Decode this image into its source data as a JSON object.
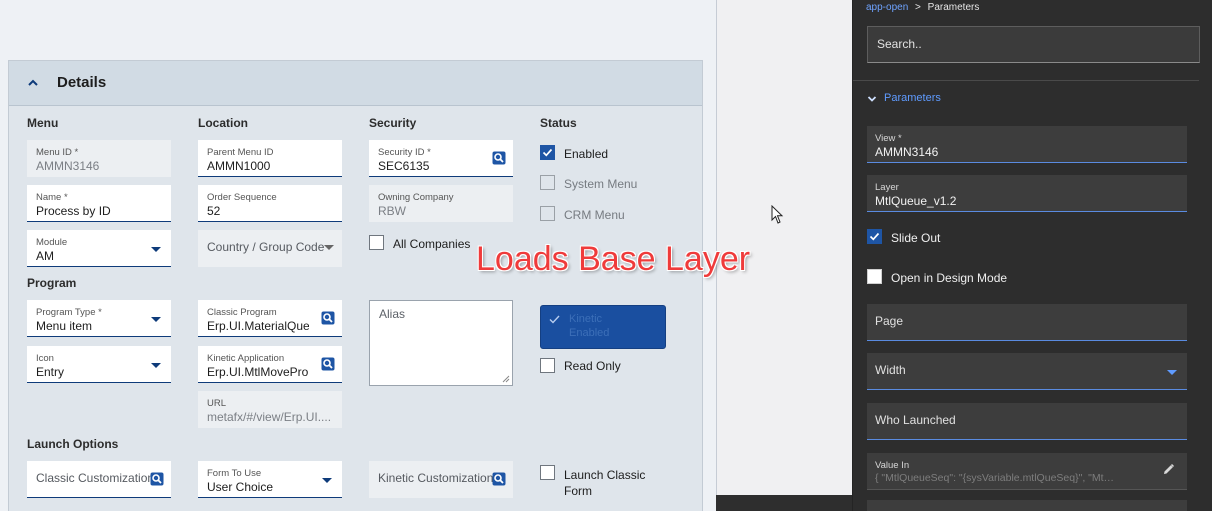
{
  "details": {
    "title": "Details",
    "sections": {
      "menu": "Menu",
      "location": "Location",
      "security": "Security",
      "status": "Status",
      "program": "Program",
      "launch_options": "Launch Options"
    },
    "menu_id": {
      "label": "Menu ID *",
      "value": "AMMN3146"
    },
    "name": {
      "label": "Name *",
      "value": "Process by ID"
    },
    "module": {
      "label": "Module",
      "value": "AM"
    },
    "parent_menu_id": {
      "label": "Parent Menu ID",
      "value": "AMMN1000"
    },
    "order_sequence": {
      "label": "Order Sequence",
      "value": "52"
    },
    "country_group_code": {
      "placeholder": "Country / Group Code"
    },
    "security_id": {
      "label": "Security ID *",
      "value": "SEC6135"
    },
    "owning_company": {
      "label": "Owning Company",
      "value": "RBW"
    },
    "all_companies": {
      "label": "All Companies",
      "checked": false
    },
    "enabled": {
      "label": "Enabled",
      "checked": true
    },
    "system_menu": {
      "label": "System Menu",
      "checked": false
    },
    "crm_menu": {
      "label": "CRM Menu",
      "checked": false
    },
    "program_type": {
      "label": "Program Type *",
      "value": "Menu item"
    },
    "icon": {
      "label": "Icon",
      "value": "Entry"
    },
    "classic_program": {
      "label": "Classic Program",
      "value": "Erp.UI.MaterialQue"
    },
    "kinetic_application": {
      "label": "Kinetic Application",
      "value": "Erp.UI.MtlMovePro"
    },
    "url": {
      "label": "URL",
      "value": "metafx/#/view/Erp.UI...."
    },
    "alias": {
      "placeholder": "Alias"
    },
    "kinetic_enabled": {
      "label": "Kinetic Enabled",
      "checked": true
    },
    "read_only": {
      "label": "Read Only",
      "checked": false
    },
    "classic_customization": {
      "placeholder": "Classic Customization"
    },
    "form_to_use": {
      "label": "Form To Use",
      "value": "User Choice"
    },
    "kinetic_customization": {
      "placeholder": "Kinetic Customization"
    },
    "launch_classic_form": {
      "label": "Launch Classic Form",
      "checked": false
    }
  },
  "overlay_text": "Loads Base Layer",
  "properties_panel": {
    "breadcrumb": {
      "parent": "app-open",
      "separator": ">",
      "current": "Parameters"
    },
    "search_placeholder": "Search..",
    "section_title": "Parameters",
    "view": {
      "label": "View *",
      "value": "AMMN3146"
    },
    "layer": {
      "label": "Layer",
      "value": "MtlQueue_v1.2"
    },
    "slide_out": {
      "label": "Slide Out",
      "checked": true
    },
    "open_in_design_mode": {
      "label": "Open in Design Mode",
      "checked": false
    },
    "page": {
      "placeholder": "Page"
    },
    "width": {
      "placeholder": "Width"
    },
    "who_launched": {
      "placeholder": "Who Launched"
    },
    "value_in": {
      "label": "Value In",
      "value": "{  \"MtlQueueSeq\": \"{sysVariable.mtlQueSeq}\",  \"Mt…"
    }
  },
  "colors": {
    "accent": "#1e55a5",
    "link": "#6ea3ff",
    "overlay": "#ef3b3b",
    "panel_bg": "#2d2d2d"
  }
}
